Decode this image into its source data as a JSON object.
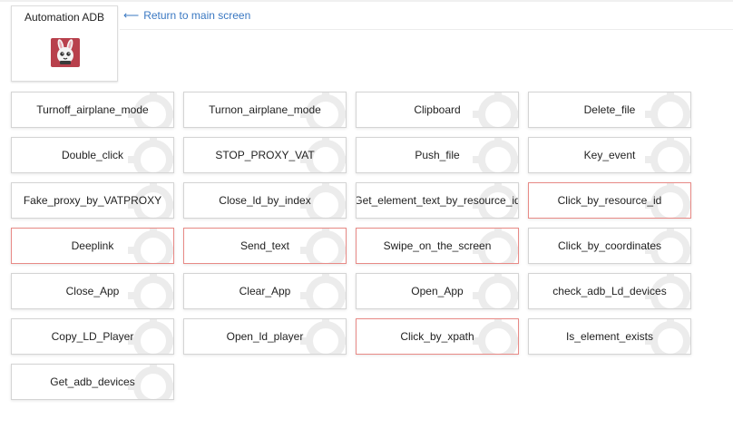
{
  "app": {
    "title": "Automation ADB",
    "logo_icon": "rabbit-logo-icon",
    "logo_color": "#b8404c"
  },
  "nav": {
    "back_label": "Return to main screen",
    "back_icon": "left-arrow-icon",
    "link_color": "#3a78c2"
  },
  "colors": {
    "error_border": "#e88a86",
    "default_border": "#d4d4d4"
  },
  "commands": [
    {
      "label": "Turnoff_airplane_mode",
      "red": false
    },
    {
      "label": "Turnon_airplane_mode",
      "red": false
    },
    {
      "label": "Clipboard",
      "red": false
    },
    {
      "label": "Delete_file",
      "red": false
    },
    {
      "label": "Double_click",
      "red": false
    },
    {
      "label": "STOP_PROXY_VAT",
      "red": false
    },
    {
      "label": "Push_file",
      "red": false
    },
    {
      "label": "Key_event",
      "red": false
    },
    {
      "label": "Fake_proxy_by_VATPROXY",
      "red": false
    },
    {
      "label": "Close_ld_by_index",
      "red": false
    },
    {
      "label": "Get_element_text_by_resource_id",
      "red": false
    },
    {
      "label": "Click_by_resource_id",
      "red": true
    },
    {
      "label": "Deeplink",
      "red": true
    },
    {
      "label": "Send_text",
      "red": true
    },
    {
      "label": "Swipe_on_the_screen",
      "red": true
    },
    {
      "label": "Click_by_coordinates",
      "red": false
    },
    {
      "label": "Close_App",
      "red": false
    },
    {
      "label": "Clear_App",
      "red": false
    },
    {
      "label": "Open_App",
      "red": false
    },
    {
      "label": "check_adb_Ld_devices",
      "red": false
    },
    {
      "label": "Copy_LD_Player",
      "red": false
    },
    {
      "label": "Open_ld_player",
      "red": false
    },
    {
      "label": "Click_by_xpath",
      "red": true
    },
    {
      "label": "Is_element_exists",
      "red": false
    },
    {
      "label": "Get_adb_devices",
      "red": false
    }
  ]
}
